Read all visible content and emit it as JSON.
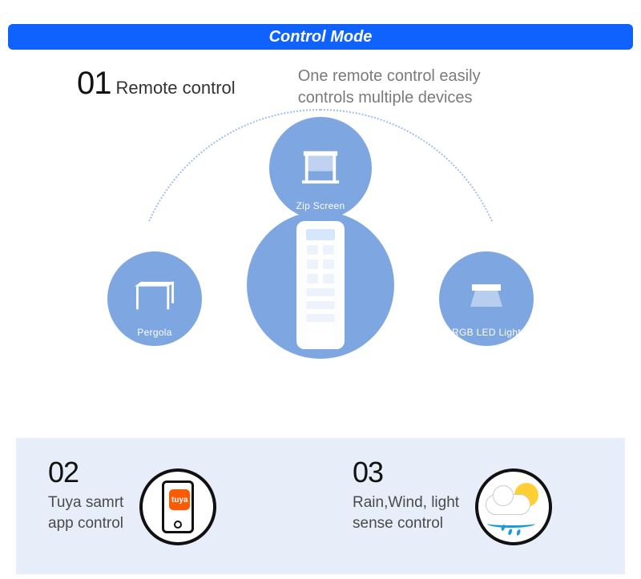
{
  "banner": "Control Mode",
  "s1": {
    "num": "01",
    "title": "Remote control",
    "desc": "One remote control easily controls multiple devices"
  },
  "nodes": {
    "top": "Zip Screen",
    "left": "Pergola",
    "right": "RGB LED Light"
  },
  "s2": {
    "num": "02",
    "line1": "Tuya samrt",
    "line2": "app control",
    "badge": "tuya"
  },
  "s3": {
    "num": "03",
    "line1": "Rain,Wind, light",
    "line2": "sense control"
  }
}
